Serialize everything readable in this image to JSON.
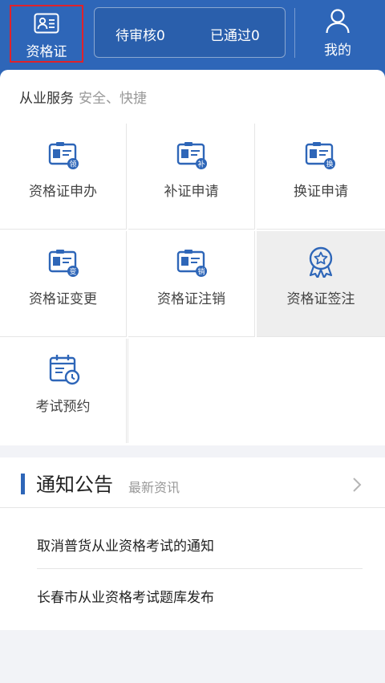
{
  "header": {
    "left_tab": {
      "label": "资格证",
      "icon": "id-card-icon"
    },
    "stats": [
      {
        "label": "待审核0"
      },
      {
        "label": "已通过0"
      }
    ],
    "right_tab": {
      "label": "我的",
      "icon": "user-icon"
    }
  },
  "services": {
    "title": "从业服务",
    "subtitle": "安全、快捷",
    "items": [
      {
        "label": "资格证申办",
        "badge": "领",
        "icon": "certificate-apply-icon"
      },
      {
        "label": "补证申请",
        "badge": "补",
        "icon": "certificate-reissue-icon"
      },
      {
        "label": "换证申请",
        "badge": "换",
        "icon": "certificate-renew-icon"
      },
      {
        "label": "资格证变更",
        "badge": "变",
        "icon": "certificate-change-icon"
      },
      {
        "label": "资格证注销",
        "badge": "销",
        "icon": "certificate-cancel-icon"
      },
      {
        "label": "资格证签注",
        "icon": "award-badge-icon"
      },
      {
        "label": "考试预约",
        "icon": "calendar-clock-icon"
      }
    ]
  },
  "notice": {
    "title": "通知公告",
    "subtitle": "最新资讯",
    "items": [
      {
        "text": "取消普货从业资格考试的通知"
      },
      {
        "text": "长春市从业资格考试题库发布"
      }
    ]
  },
  "colors": {
    "primary": "#2e66b8",
    "highlight": "#e0222a"
  }
}
